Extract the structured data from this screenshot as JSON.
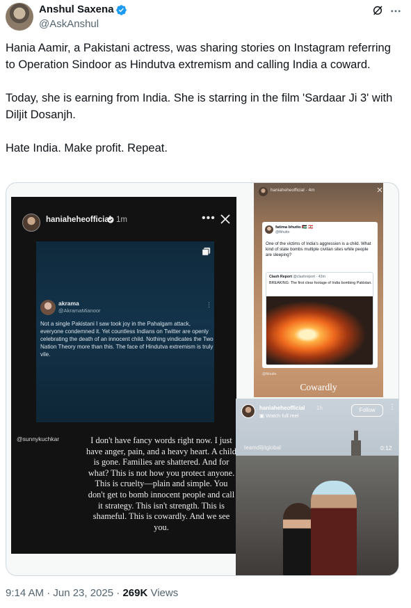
{
  "author": {
    "name": "Anshul Saxena",
    "handle": "@AskAnshul",
    "verified_color": "#1d9bf0",
    "avatar_icon": "profile-photo"
  },
  "tweet": {
    "paragraphs": [
      "Hania Aamir, a Pakistani actress, was sharing stories on Instagram referring to Operation Sindoor as Hindutva extremism and calling India a coward.",
      "Today, she is earning from India. She is starring in the film 'Sardaar Ji 3' with Diljit Dosanjh.",
      "Hate India. Make profit. Repeat."
    ]
  },
  "media": {
    "story_left": {
      "username": "haniaheheofficial",
      "time": "1m",
      "embedded_post": {
        "name": "akrama",
        "handle": "@AkramaMianoor",
        "text": "Not a single Pakistani I saw took joy in the Pahalgam attack, everyone condemned it. Yet countless Indians on Twitter are openly celebrating the death of an innocent child. Nothing vindicates the Two Nation Theory more than this. The face of Hindutva extremism is truly vile."
      },
      "mention": "@sunnykuchkar",
      "caption": "I don't have fancy words right now. I just have anger, pain, and a heavy heart. A child is gone. Families are shattered. And for what? This is not how you protect anyone. This is cruelty—plain and simple. You don't get to bomb innocent people and call it strategy. This isn't strength. This is shameful. This is cowardly. And we see you."
    },
    "story_top_right": {
      "username": "haniaheheofficial",
      "time": "4m",
      "card": {
        "name": "fatima bhutto 🇵🇸 🇱🇧",
        "handle": "@fbhutto",
        "text": "One of the victims of India's aggression is a child. What kind of state bombs multiple civilian sites while people are sleeping?",
        "quote_name": "Clash Report",
        "quote_meta": "@clashreport · 43m",
        "quote_text": "BREAKING: The first clear footage of India bombing Pakistan."
      },
      "handle2": "@fbhutto",
      "caption": "Cowardly"
    },
    "reel": {
      "username": "haniaheheofficial",
      "time": "1h",
      "watch_label": "Watch full reel",
      "follow_label": "Follow",
      "watermark": "teamdiljitglobal",
      "duration": "0:12"
    }
  },
  "footer": {
    "time": "9:14 AM · Jun 23, 2025 · ",
    "views_count": "269K",
    "views_label": " Views"
  }
}
